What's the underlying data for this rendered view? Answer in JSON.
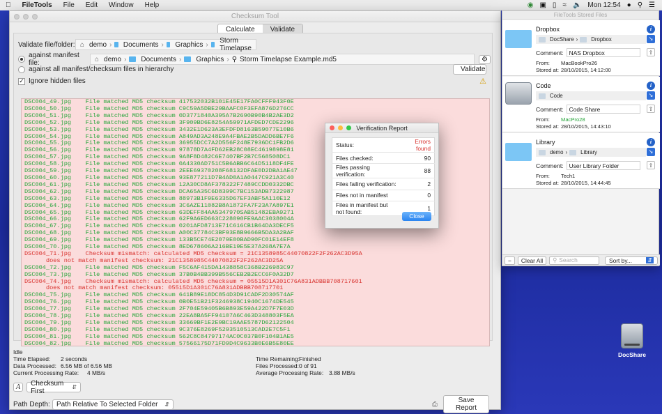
{
  "menubar": {
    "app": "FileTools",
    "items": [
      "File",
      "Edit",
      "Window",
      "Help"
    ],
    "clock": "Mon 12:54"
  },
  "window": {
    "title": "Checksum Tool",
    "tabs": [
      "Calculate",
      "Validate"
    ],
    "active_tab": "Validate"
  },
  "validate": {
    "label": "Validate file/folder:",
    "path": [
      "demo",
      "Documents",
      "Graphics",
      "Storm Timelapse"
    ]
  },
  "manifest": {
    "label": "against manifest file:",
    "path": [
      "demo",
      "Documents",
      "Graphics",
      "Storm Timelapse Example.md5"
    ]
  },
  "all_manifest_label": "against all manifest/checksum files in hierarchy",
  "validate_button": "Validate",
  "ignore_hidden": "Ignore hidden files",
  "log": [
    {
      "f": "DSC004_49.jpg",
      "ok": true,
      "sum": "417532032B101E45E17FA0CFFF943F0E"
    },
    {
      "f": "DSC004_50.jpg",
      "ok": true,
      "sum": "C9C59A5DBE29BAAFC0F3EFA876D276CC"
    },
    {
      "f": "DSC004_51.jpg",
      "ok": true,
      "sum": "0D3771840A395A7B2690B90B4B2AE3D2"
    },
    {
      "f": "DSC004_52.jpg",
      "ok": true,
      "sum": "3F909BD6E8254A59971AFDED7CDE2296"
    },
    {
      "f": "DSC004_53.jpg",
      "ok": true,
      "sum": "3432E1D623A3EFDFD8163B59077E10B6"
    },
    {
      "f": "DSC004_54.jpg",
      "ok": true,
      "sum": "A849AD3A248E9A4FBAE2B5DADD6BE7F6"
    },
    {
      "f": "DSC004_55.jpg",
      "ok": true,
      "sum": "36955DCC7A2D556F248E7936DC1FB2D6"
    },
    {
      "f": "DSC004_56.jpg",
      "ok": true,
      "sum": "97878D7A4FD62EB28C08EC4619898E81"
    },
    {
      "f": "DSC004_57.jpg",
      "ok": true,
      "sum": "9A8F8D482C6E7407BF2B7C568508DC1"
    },
    {
      "f": "DSC004_58.jpg",
      "ok": true,
      "sum": "0A4330AD751C5B6ABB6C64D5118DF4FE"
    },
    {
      "f": "DSC004_59.jpg",
      "ok": true,
      "sum": "2EEE69370208F68132DFAE0D2DBA1AE47"
    },
    {
      "f": "DSC004_60.jpg",
      "ok": true,
      "sum": "93E877211D7B4AD0A1A0447C921A3C40"
    },
    {
      "f": "DSC004_61.jpg",
      "ok": true,
      "sum": "12A30CD8AF378322F7489CCDD0332DBC"
    },
    {
      "f": "DSC004_62.jpg",
      "ok": true,
      "sum": "DCA65A35C6D8399C7BC153ADB7322987"
    },
    {
      "f": "DSC004_63.jpg",
      "ok": true,
      "sum": "88973B1F9E6335D67EF3ABF5A110E12"
    },
    {
      "f": "DSC004_64.jpg",
      "ok": true,
      "sum": "3C6AZE11082B8A1872FA7F23A7A897E1"
    },
    {
      "f": "DSC004_65.jpg",
      "ok": true,
      "sum": "63DEFF84AA5347970SAB51482EBA9271"
    },
    {
      "f": "DSC004_66.jpg",
      "ok": true,
      "sum": "62F9A6ED663C228090FE9AAC3038004A"
    },
    {
      "f": "DSC004_67.jpg",
      "ok": true,
      "sum": "0201AFD8713E71C616CB1B64DA3DECF5"
    },
    {
      "f": "DSC004_68.jpg",
      "ok": true,
      "sum": "A00C37784C3BF93E8B9666B5DA3A2BAF"
    },
    {
      "f": "DSC004_69.jpg",
      "ok": true,
      "sum": "133B5CE74E2079E00BAD90FC01E14EF8"
    },
    {
      "f": "DSC004_70.jpg",
      "ok": true,
      "sum": "8ED678606A216BE19E5E37A268A7E7A"
    },
    {
      "f": "DSC004_71.jpg",
      "ok": false,
      "calc": "21C1358985C44070822F2F262AC3D95A",
      "man": "21C1358985C44070822F2F262AC3D25A"
    },
    {
      "f": "DSC004_72.jpg",
      "ok": true,
      "sum": "F5C6AF415DA1438858C368B226983C97"
    },
    {
      "f": "DSC004_73.jpg",
      "ok": true,
      "sum": "37B0B4BB399B556CEB2B2ECC6F0A32D7"
    },
    {
      "f": "DSC004_74.jpg",
      "ok": false,
      "calc": "05515D1A301C76A831ADBBB708717601",
      "man": "05515D1A301C76A831ADBBB708717701"
    },
    {
      "f": "DSC004_75.jpg",
      "ok": true,
      "sum": "641B89E18DC854D3D91CADF2D30574AF"
    },
    {
      "f": "DSC004_76.jpg",
      "ok": true,
      "sum": "0B0E51B21F3246938C1940C1674DE545"
    },
    {
      "f": "DSC004_77.jpg",
      "ok": true,
      "sum": "2F704E59405B6B893E59A422D7F7E03D"
    },
    {
      "f": "DSC004_78.jpg",
      "ok": true,
      "sum": "22EA8BA5FF94107A6C463D348803F5EA"
    },
    {
      "f": "DSC004_79.jpg",
      "ok": true,
      "sum": "33669BF1E2E9BC19AAE5787D62122504"
    },
    {
      "f": "DSC004_80.jpg",
      "ok": true,
      "sum": "9C376E8269F5293510513CAD2E7C5F1"
    },
    {
      "f": "DSC004_81.jpg",
      "ok": true,
      "sum": "562C8C84797174AC0C037B0F104B1AE5"
    },
    {
      "f": "DSC004_82.jpg",
      "ok": true,
      "sum": "57566175D71FD9D4C9633B0E6B5E80EE"
    }
  ],
  "log_text": {
    "match": "File matched MD5 checksum",
    "mismatch": "Checksum mismatch: calculated MD5 checksum =",
    "nomatch": "does not match manifest checksum:"
  },
  "status": {
    "state": "Idle",
    "left": [
      {
        "k": "Time Elapsed:",
        "v": "2 seconds"
      },
      {
        "k": "Data Processed:",
        "v": "6.56 MB of 6.56 MB"
      },
      {
        "k": "Current Processing Rate:",
        "v": "4 MB/s"
      }
    ],
    "right": [
      {
        "k": "Time Remaining:",
        "v": "Finished"
      },
      {
        "k": "Files Processed:",
        "v": "0 of 91"
      },
      {
        "k": "Average Processing Rate:",
        "v": "3.88 MB/s"
      }
    ]
  },
  "controls": {
    "order": "Checksum First",
    "depth_label": "Path Depth:",
    "depth": "Path Relative To Selected Folder",
    "save": "Save Report"
  },
  "report": {
    "title": "Verification Report",
    "rows": [
      {
        "k": "Status:",
        "v": "Errors found",
        "err": true
      },
      {
        "k": "Files checked:",
        "v": "90"
      },
      {
        "k": "Files passing verification:",
        "v": "88"
      },
      {
        "k": "Files failing verification:",
        "v": "2"
      },
      {
        "k": "Files not in manifest",
        "v": "0"
      },
      {
        "k": "Files in manifest but not found:",
        "v": "1"
      }
    ],
    "close": "Close"
  },
  "stored": {
    "title": "FileTools Stored Files",
    "items": [
      {
        "name": "Dropbox",
        "path": [
          "DocShare",
          "Dropbox"
        ],
        "comment": "NAS Dropbox",
        "from": "MacBookPro26",
        "from_link": false,
        "stored": "28/10/2015, 14:12:00",
        "icon": "folder-icon"
      },
      {
        "name": "Code",
        "path": [
          "Code"
        ],
        "comment": "Code Share",
        "from": "MacPro28",
        "from_link": true,
        "stored": "28/10/2015, 14:43:10",
        "icon": "drive-icon"
      },
      {
        "name": "Library",
        "path": [
          "demo",
          "Library"
        ],
        "comment": "User Library Folder",
        "from": "Tech1",
        "from_link": false,
        "stored": "28/10/2015, 14:44:45",
        "icon": "library-folder-icon"
      }
    ],
    "labels": {
      "comment": "Comment:",
      "from": "From:",
      "stored": "Stored at:"
    },
    "clear": "Clear All",
    "search": "Search",
    "sort": "Sort by..."
  },
  "desktop_icon": "DocShare",
  "colors": {
    "ok": "#27a53b",
    "bad": "#d8322e",
    "accent": "#2a84f1"
  }
}
